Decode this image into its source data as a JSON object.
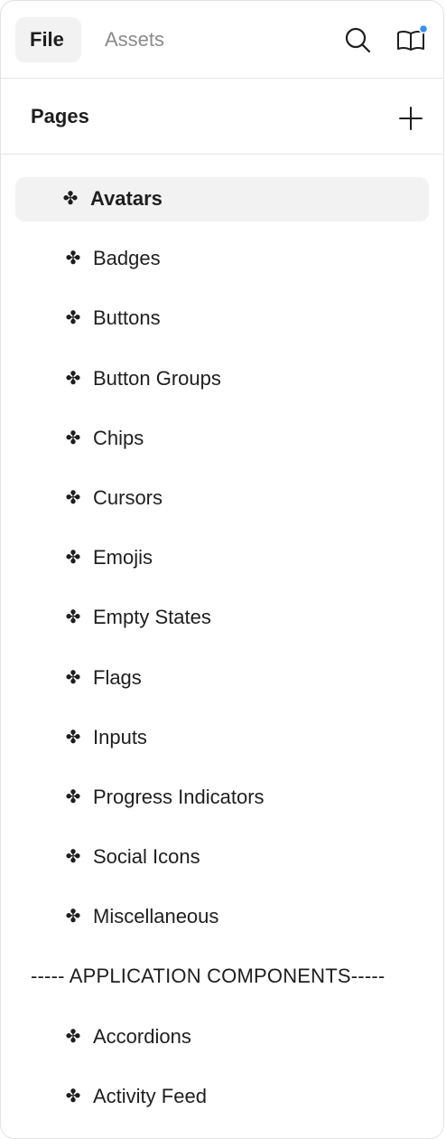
{
  "header": {
    "tabs": [
      {
        "label": "File",
        "active": true
      },
      {
        "label": "Assets",
        "active": false
      }
    ],
    "icons": {
      "search": "search-icon",
      "library": "book-icon",
      "notification_dot_color": "#3b8ff0"
    }
  },
  "pages_section": {
    "title": "Pages",
    "add_icon": "plus-icon",
    "items": [
      {
        "icon": "✤",
        "label": "Avatars",
        "active": true
      },
      {
        "icon": "✤",
        "label": "Badges"
      },
      {
        "icon": "✤",
        "label": "Buttons"
      },
      {
        "icon": "✤",
        "label": "Button Groups"
      },
      {
        "icon": "✤",
        "label": "Chips"
      },
      {
        "icon": "✤",
        "label": "Cursors"
      },
      {
        "icon": "✤",
        "label": "Emojis"
      },
      {
        "icon": "✤",
        "label": "Empty States"
      },
      {
        "icon": "✤",
        "label": "Flags"
      },
      {
        "icon": "✤",
        "label": "Inputs"
      },
      {
        "icon": "✤",
        "label": "Progress Indicators"
      },
      {
        "icon": "✤",
        "label": "Social Icons"
      },
      {
        "icon": "✤",
        "label": "Miscellaneous"
      },
      {
        "label": "----- APPLICATION COMPONENTS-----"
      },
      {
        "icon": "✤",
        "label": "Accordions"
      },
      {
        "icon": "✤",
        "label": "Activity Feed"
      }
    ]
  },
  "colors": {
    "active_bg": "#f2f2f2",
    "text": "#1e1e1e",
    "muted_text": "#8a8a8a",
    "accent_dot": "#3b8ff0"
  }
}
